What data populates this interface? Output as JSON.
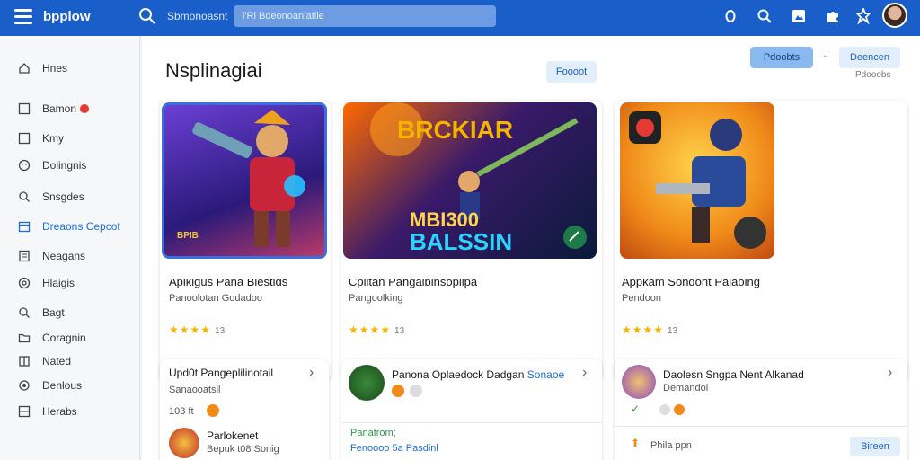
{
  "topbar": {
    "brand": "bpplow",
    "search_label": "Sbmonoasnt",
    "search_placeholder": "l'Ri Bdeonoaniatile"
  },
  "sidebar": {
    "items": [
      {
        "label": "Hnes"
      },
      {
        "label": "Bamon"
      },
      {
        "label": "Kmy"
      },
      {
        "label": "Dolingnis"
      },
      {
        "label": "Snsgdes"
      },
      {
        "label": "Dreaons Cepcot"
      },
      {
        "label": "Neagans"
      },
      {
        "label": "Hlaigis"
      },
      {
        "label": "Bagt"
      },
      {
        "label": "Coragnin"
      },
      {
        "label": "Nated"
      },
      {
        "label": "Denlous"
      },
      {
        "label": "Herabs"
      }
    ]
  },
  "main": {
    "title": "Nsplinagiai",
    "filter_label": "Foooot",
    "primary_label": "Pdoobts",
    "secondary_label": "Deencen",
    "sub_label": "Pdooobs"
  },
  "cards": [
    {
      "title": "Aplkigus Pana Blestids",
      "sub": "Panoolotan Godadoo",
      "stars": "★★★★",
      "count": "13"
    },
    {
      "title": "Cplitan Pangalbinsopllpa",
      "sub": "Pangoolking",
      "stars": "★★★★",
      "count": "13"
    },
    {
      "title": "Appkam Sondont Palaoing",
      "sub": "Pendoon",
      "stars": "★★★★",
      "count": "13"
    }
  ],
  "hero_text": {
    "banner_top": "BRCKIAR",
    "banner_mid": "MBI300",
    "banner_bot": "BALSSIN",
    "badge": "BPIB"
  },
  "list_cards": [
    {
      "title": "Upd0t Pangeplilinotail",
      "sub": "Sanaooatsil",
      "meta": "103 ft",
      "sub_title": "Parlokenet",
      "sub_desc": "Bepuk t08 Sonig"
    },
    {
      "title": "Panona Oplaedock Dadgan",
      "title_link": "Sonaoe",
      "link1": "Panatrom;",
      "link2": "Fenoooo 5a Pasdinl"
    },
    {
      "title": "Daolesn Sngpa Nent Alkanad",
      "sub": "Demandol",
      "foot": "Phila ppn",
      "foot_btn": "Bireen"
    }
  ],
  "colors": {
    "accent": "#1a5fc9",
    "star": "#f5b400",
    "badge_red": "#e53935"
  }
}
